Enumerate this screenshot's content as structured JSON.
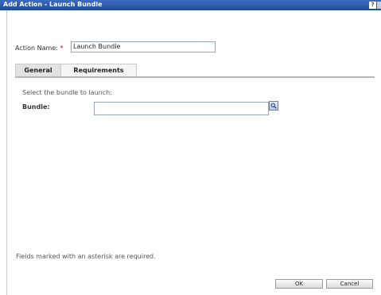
{
  "window": {
    "title": "Add Action - Launch Bundle",
    "help_label": "?"
  },
  "form": {
    "action_name_label": "Action Name:",
    "required_marker": "*",
    "action_name_value": "Launch Bundle"
  },
  "tabs": [
    {
      "label": "General",
      "active": true
    },
    {
      "label": "Requirements",
      "active": false
    }
  ],
  "general": {
    "hint": "Select the bundle to launch:",
    "bundle_label": "Bundle:",
    "bundle_value": "",
    "browse_icon": "search-icon"
  },
  "footer": {
    "note": "Fields marked with an asterisk are required.",
    "ok_label": "OK",
    "cancel_label": "Cancel"
  }
}
